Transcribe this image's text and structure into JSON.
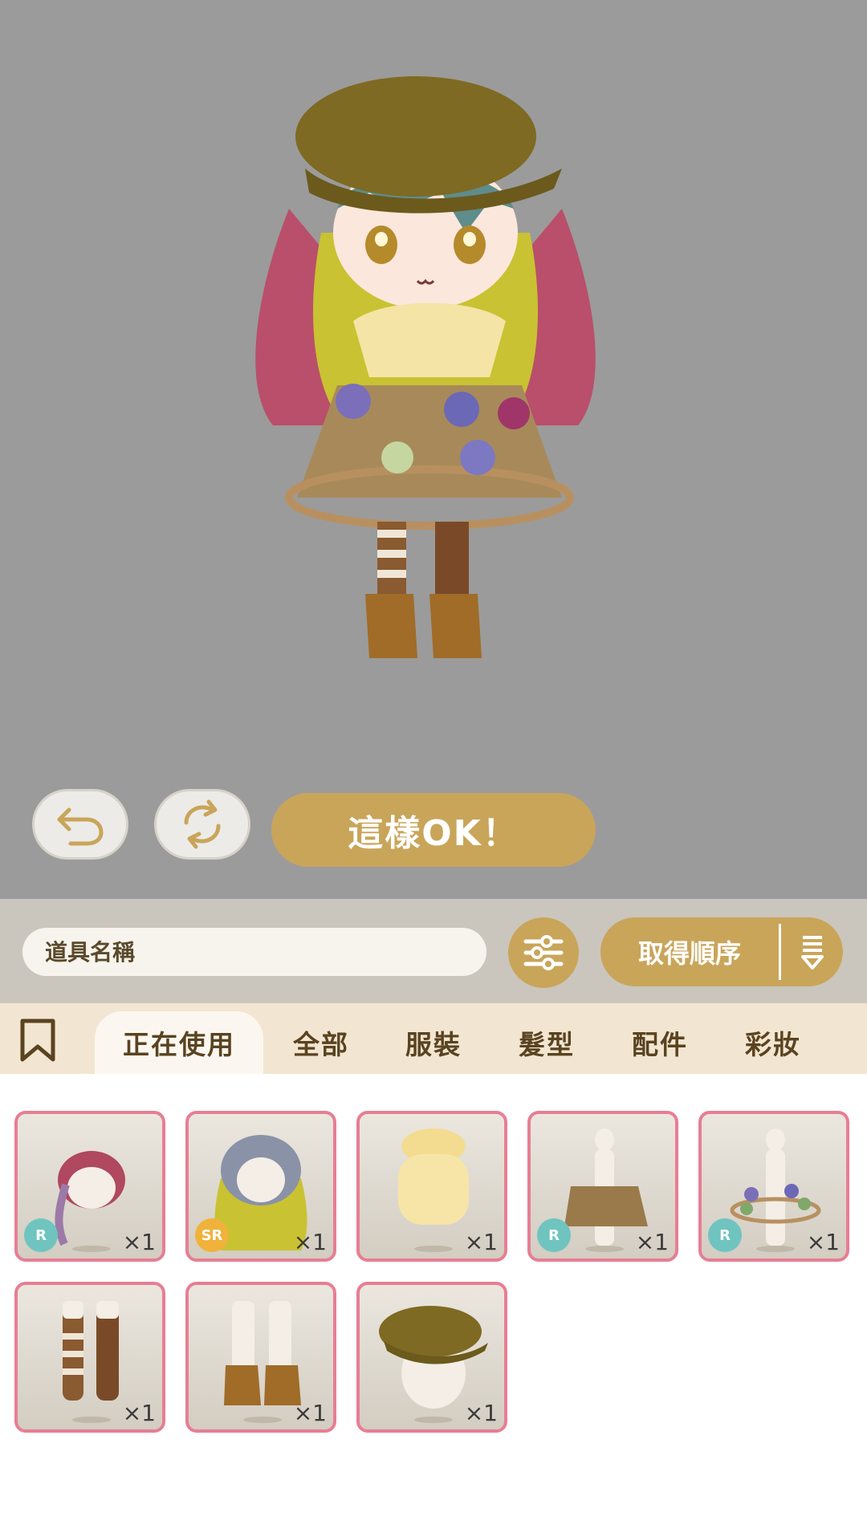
{
  "controls": {
    "ok_label": "這樣OK！"
  },
  "toolbar": {
    "search_placeholder": "道具名稱",
    "sort_label": "取得順序"
  },
  "tabs": [
    {
      "label": "正在使用",
      "active": true
    },
    {
      "label": "全部",
      "active": false
    },
    {
      "label": "服裝",
      "active": false
    },
    {
      "label": "髮型",
      "active": false
    },
    {
      "label": "配件",
      "active": false
    },
    {
      "label": "彩妝",
      "active": false
    }
  ],
  "items": [
    {
      "name": "hair-braid",
      "rarity": "R",
      "qty": "×1"
    },
    {
      "name": "hair-long-wavy",
      "rarity": "SR",
      "qty": "×1"
    },
    {
      "name": "top-ruffle",
      "rarity": "",
      "qty": "×1"
    },
    {
      "name": "skirt-plaid",
      "rarity": "R",
      "qty": "×1"
    },
    {
      "name": "cage-skirt",
      "rarity": "R",
      "qty": "×1"
    },
    {
      "name": "stockings",
      "rarity": "",
      "qty": "×1"
    },
    {
      "name": "boots",
      "rarity": "",
      "qty": "×1"
    },
    {
      "name": "newsboy-cap",
      "rarity": "",
      "qty": "×1"
    }
  ],
  "colors": {
    "accent": "#c9a55a",
    "card_border": "#e77e93",
    "rarity_r": "#6fc4c0",
    "rarity_sr": "#f0b23a"
  }
}
